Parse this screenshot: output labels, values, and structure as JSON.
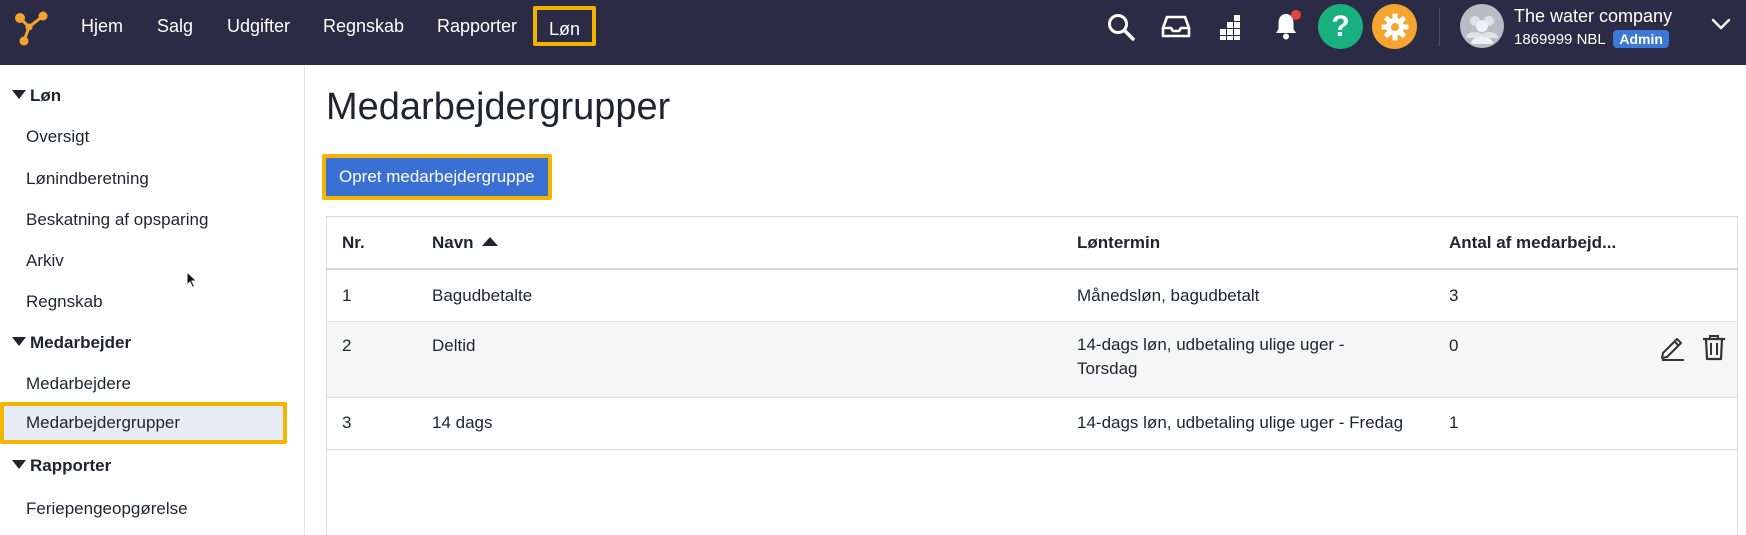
{
  "topnav": {
    "items": [
      {
        "label": "Hjem"
      },
      {
        "label": "Salg"
      },
      {
        "label": "Udgifter"
      },
      {
        "label": "Regnskab"
      },
      {
        "label": "Rapporter"
      },
      {
        "label": "Løn",
        "active": true
      }
    ],
    "icons": [
      "search-icon",
      "inbox-icon",
      "apps-grid-icon",
      "bell-icon",
      "help-icon",
      "settings-icon"
    ],
    "help_glyph": "?",
    "has_notification": true,
    "colors": {
      "bar": "#2b2b45",
      "highlight": "#f4b400",
      "help": "#19b07f",
      "settings": "#f3a530",
      "notification": "#e8423a"
    }
  },
  "account": {
    "company": "The water company",
    "id": "1869999 NBL",
    "role": "Admin",
    "badge_color": "#3c78d8"
  },
  "sidebar": {
    "groups": [
      {
        "label": "Løn",
        "items": [
          "Oversigt",
          "Lønindberetning",
          "Beskatning af opsparing",
          "Arkiv",
          "Regnskab"
        ]
      },
      {
        "label": "Medarbejder",
        "items": [
          "Medarbejdere",
          "Medarbejdergrupper"
        ]
      },
      {
        "label": "Rapporter",
        "items": [
          "Feriepengeopgørelse"
        ]
      }
    ],
    "selected": "Medarbejdergrupper"
  },
  "main": {
    "title": "Medarbejdergrupper",
    "create_button": "Opret medarbejdergruppe",
    "primary_color": "#3a6fd3",
    "table": {
      "columns": [
        "Nr.",
        "Navn",
        "Løntermin",
        "Antal af medarbejd..."
      ],
      "sort": {
        "column": "Navn",
        "direction": "ascending"
      },
      "rows": [
        {
          "nr": "1",
          "navn": "Bagudbetalte",
          "loentermin": "Månedsløn, bagudbetalt",
          "antal": "3"
        },
        {
          "nr": "2",
          "navn": "Deltid",
          "loentermin": "14-dags løn, udbetaling ulige uger - Torsdag",
          "antal": "0",
          "hovered": true
        },
        {
          "nr": "3",
          "navn": "14 dags",
          "loentermin": "14-dags løn, udbetaling ulige uger - Fredag",
          "antal": "1"
        }
      ],
      "row_action_icons": [
        "edit-pencil-icon",
        "delete-trash-icon"
      ]
    }
  }
}
